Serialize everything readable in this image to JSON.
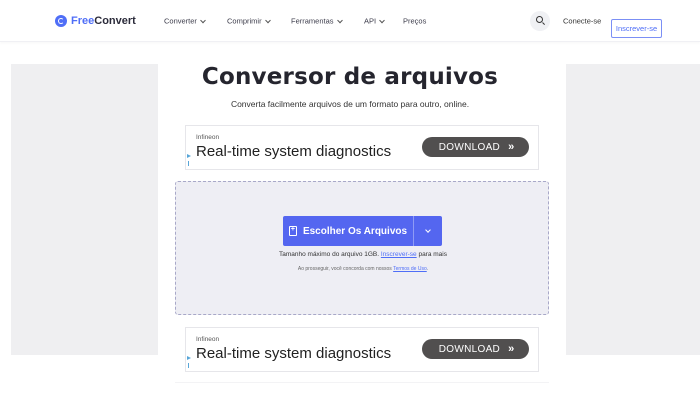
{
  "header": {
    "logo": {
      "part1": "Free",
      "part2": "Convert"
    },
    "nav": [
      {
        "label": "Converter",
        "has_dropdown": true
      },
      {
        "label": "Comprimir",
        "has_dropdown": true
      },
      {
        "label": "Ferramentas",
        "has_dropdown": true
      },
      {
        "label": "API",
        "has_dropdown": true
      },
      {
        "label": "Preços",
        "has_dropdown": false
      }
    ],
    "search_icon": "search-icon",
    "login_label": "Conecte-se",
    "signup_label": "Inscrever-se"
  },
  "main": {
    "title": "Conversor de arquivos",
    "subtitle": "Converta facilmente arquivos de um formato para outro, online."
  },
  "ads": [
    {
      "brand": "Infineon",
      "headline": "Real-time system diagnostics",
      "button_label": "DOWNLOAD",
      "button_icon": "»"
    },
    {
      "brand": "Infineon",
      "headline": "Real-time system diagnostics",
      "button_label": "DOWNLOAD",
      "button_icon": "»"
    }
  ],
  "upload": {
    "button_label": "Escolher Os Arquivos",
    "file_icon": "file-plus-icon",
    "dropdown_icon": "chevron-down-icon",
    "max_size_prefix": "Tamanho máximo do arquivo 1GB.",
    "max_size_link": "Inscrever-se",
    "max_size_suffix": "para mais",
    "terms_prefix": "Ao prosseguir, você concorda com nossos",
    "terms_link": "Termos de Uso",
    "terms_suffix": "."
  },
  "colors": {
    "accent": "#4f6ef7",
    "button_primary": "#5466f0",
    "dropzone_bg": "#eeeef4",
    "ad_button": "#514f4f",
    "side_panel": "#efeff1"
  }
}
